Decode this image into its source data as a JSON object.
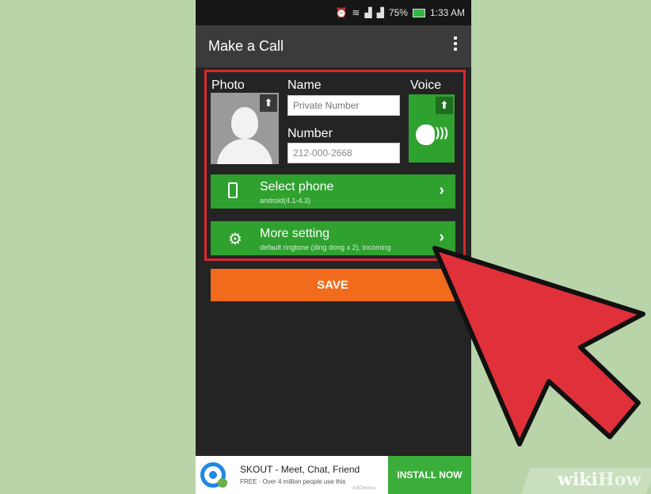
{
  "status_bar": {
    "icons": [
      "alarm-icon",
      "wifi-icon",
      "signal-icon",
      "signal-icon"
    ],
    "battery": "75%",
    "time": "1:33 AM"
  },
  "action_bar": {
    "title": "Make a Call",
    "overflow_icon": "overflow-menu-icon"
  },
  "form": {
    "photo_label": "Photo",
    "name_label": "Name",
    "name_placeholder": "Private Number",
    "number_label": "Number",
    "number_value": "212-000-2668",
    "voice_label": "Voice"
  },
  "rows": [
    {
      "title": "Select phone",
      "subtitle": "android(4.1-4.3)",
      "icon": "phone-icon"
    },
    {
      "title": "More setting",
      "subtitle": "default ringtone (ding dong x 2), incoming",
      "icon": "gear-icon"
    }
  ],
  "save_label": "SAVE",
  "ad": {
    "title": "SKOUT - Meet, Chat, Friend",
    "subtitle": "FREE · Over 4 million people use this",
    "choices": "AdChoices",
    "install_label": "INSTALL NOW"
  },
  "watermark": {
    "wiki": "wiki",
    "how": "How"
  },
  "colors": {
    "accent_green": "#2fa12f",
    "save_orange": "#f26a1b",
    "highlight_red": "#d8282f",
    "background": "#b9d4a8"
  }
}
